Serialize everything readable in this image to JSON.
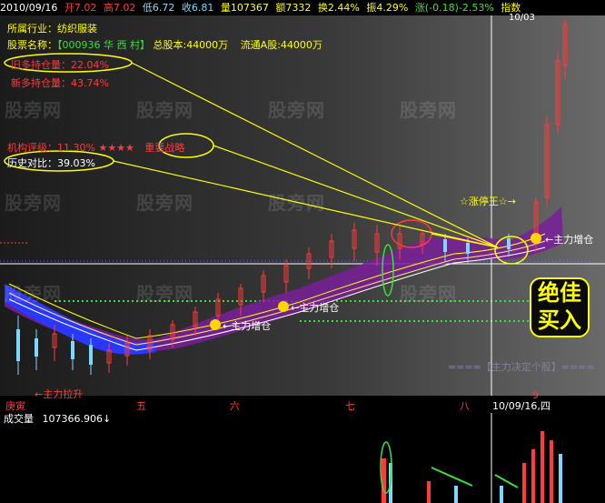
{
  "topbar": {
    "date": "2010/09/16",
    "open": "开7.02",
    "high": "高7.02",
    "low": "低6.72",
    "close": "收6.81",
    "volume": "量107367",
    "amount": "额7332",
    "turnover": "换2.44%",
    "amplitude": "振4.29%",
    "change": "涨(-0.18)-2.53%",
    "index_label": "指数",
    "crosshair_date": "10/03"
  },
  "info": {
    "industry_label": "所属行业：",
    "industry_value": "纺织服装",
    "stock_name_label": "股票名称：",
    "stock_code": "【000936 华 西 村】",
    "total_shares": "总股本:44000万",
    "float_shares": "流通A股:44000万",
    "old_holding": "旧多持仓量：22.04%",
    "new_holding": "新多持仓量：43.74%",
    "rating": "机构评级：11.30%",
    "rating_stars": "★★★★",
    "rating_tag": "重要战略",
    "history_compare": "历史对比：39.03%"
  },
  "annotations": {
    "limit_up_king": "☆涨停王☆→",
    "main_increase_1": "←主力增仓",
    "main_increase_2": "←主力增仓",
    "main_increase_3": "←主力增仓",
    "bottom_mark": "←主力拉升",
    "decide_stock": "====【主力决定个股】====",
    "best_buy_line1": "绝佳",
    "best_buy_line2": "买入"
  },
  "axis": {
    "label_1": "庚寅",
    "label_2": "五",
    "label_3": "六",
    "label_4": "七",
    "label_5": "八",
    "crosshair_label": "10/09/16,四",
    "label_6": "9"
  },
  "volume": {
    "label": "成交量",
    "value": "107366.906↓"
  },
  "watermark": {
    "text": "股旁网"
  },
  "colors": {
    "up": "#ff3b3b",
    "down": "#7fd7ff",
    "highlight": "#ffff00",
    "ma_green": "#38e038",
    "band_blue": "#2a38ff",
    "band_purple": "#7a1f9a"
  }
}
